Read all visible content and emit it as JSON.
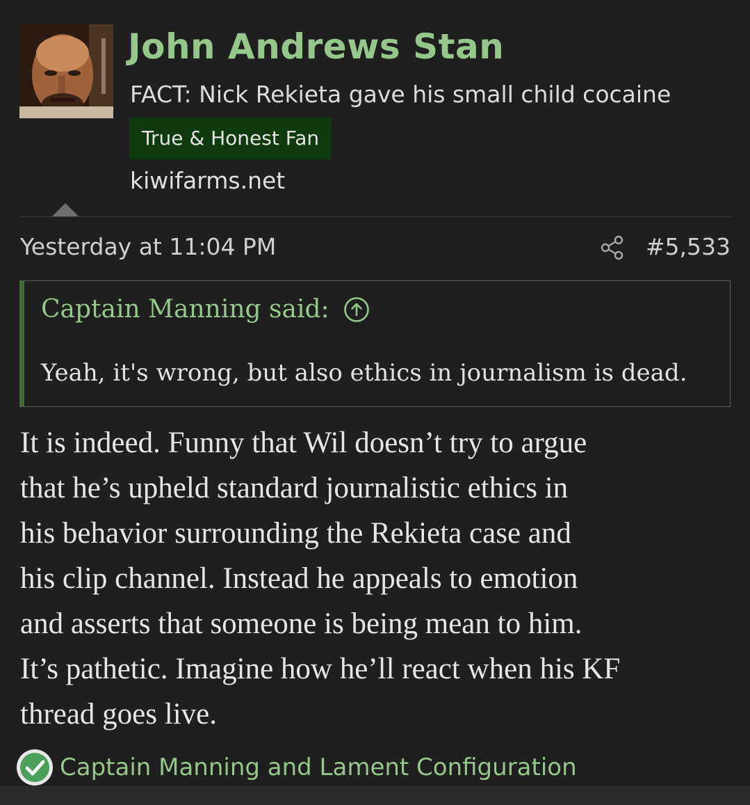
{
  "user": {
    "name": "John Andrews Stan",
    "title": "FACT: Nick Rekieta gave his small child cocaine",
    "banner": "True & Honest Fan",
    "extra": "kiwifarms.net",
    "avatar_icon": "avatar-photo"
  },
  "post": {
    "date": "Yesterday at 11:04 PM",
    "number": "#5,533",
    "share_icon": "share-icon",
    "quote": {
      "author_label": "Captain Manning said:",
      "jump_icon": "arrow-up-circle-icon",
      "text": "Yeah, it's wrong, but also ethics in journalism is dead."
    },
    "body_lines": [
      "It is indeed. Funny that Wil doesn’t try to argue",
      "that he’s upheld standard journalistic ethics in",
      "his behavior surrounding the Rekieta case and",
      "his clip channel. Instead he appeals to emotion",
      "and asserts that someone is being mean to him.",
      "It’s pathetic. Imagine how he’ll react when his KF",
      "thread goes live."
    ]
  },
  "reactions": {
    "icon": "check-icon",
    "users": "Captain Manning and Lament Configuration"
  },
  "colors": {
    "accent_green": "#95c78a",
    "banner_bg": "#0f3a0f",
    "quote_border": "#3f6e34",
    "background": "#1f1f1f"
  }
}
